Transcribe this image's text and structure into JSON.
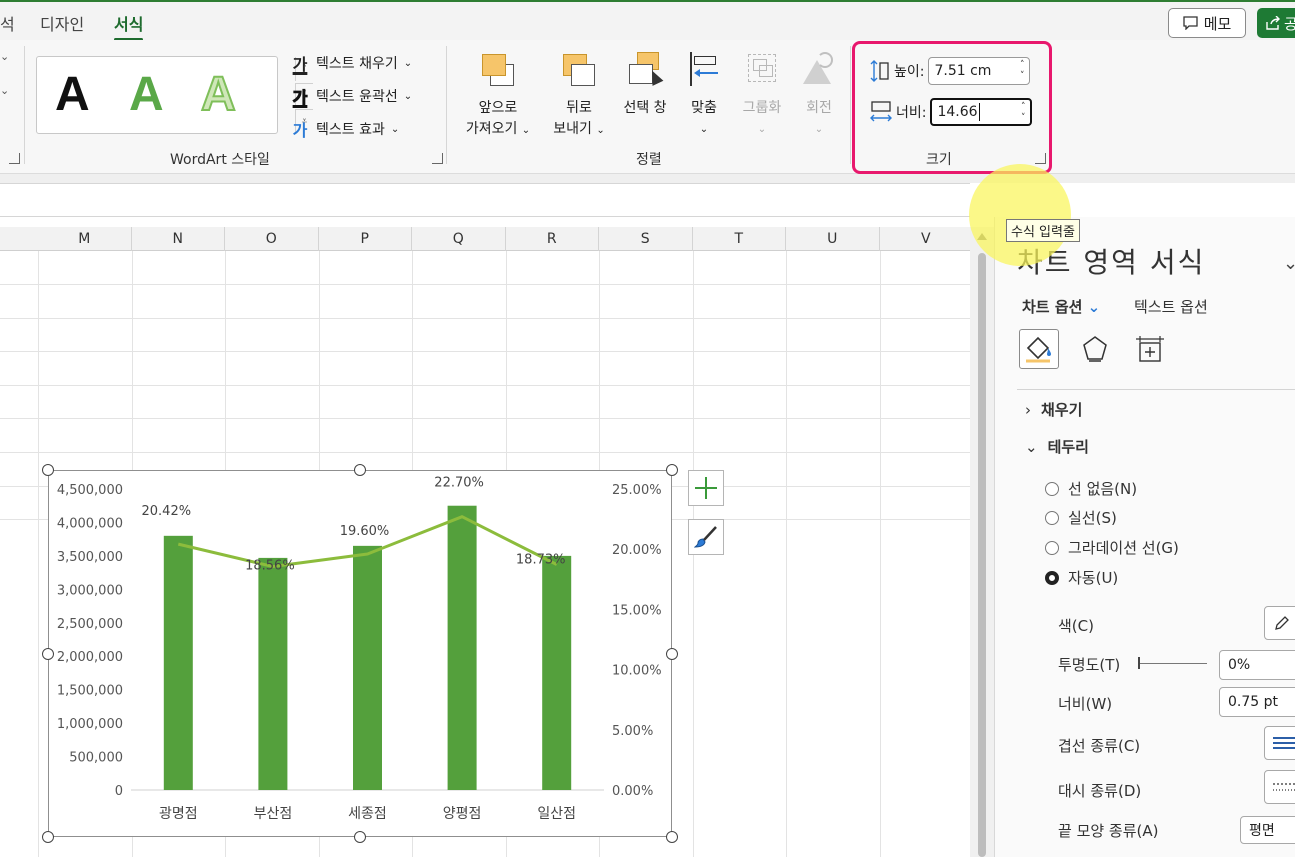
{
  "ribbon": {
    "tabs": [
      {
        "label": "석"
      },
      {
        "label": "디자인"
      },
      {
        "label": "서식"
      }
    ],
    "memo_label": "메모",
    "share_label": "공",
    "wordart": {
      "letters": [
        "A",
        "A",
        "A"
      ],
      "group_label": "WordArt 스타일",
      "commands": [
        {
          "icon_text": "가",
          "label": "텍스트 채우기"
        },
        {
          "icon_text": "가",
          "label": "텍스트 윤곽선"
        },
        {
          "icon_text": "가",
          "label": "텍스트 효과"
        }
      ]
    },
    "arrange": {
      "group_label": "정렬",
      "buttons": [
        {
          "line1": "앞으로",
          "line2": "가져오기",
          "dropdown": true,
          "disabled": false
        },
        {
          "line1": "뒤로",
          "line2": "보내기",
          "dropdown": true,
          "disabled": false
        },
        {
          "line1": "선택 창",
          "line2": "",
          "dropdown": false,
          "disabled": false
        },
        {
          "line1": "맞춤",
          "line2": "",
          "dropdown": true,
          "disabled": false
        },
        {
          "line1": "그룹화",
          "line2": "",
          "dropdown": true,
          "disabled": true
        },
        {
          "line1": "회전",
          "line2": "",
          "dropdown": true,
          "disabled": true
        }
      ]
    },
    "size": {
      "group_label": "크기",
      "height_label": "높이:",
      "height_value": "7.51 cm",
      "width_label": "너비:",
      "width_value": "14.66"
    }
  },
  "grid": {
    "columns": [
      "M",
      "N",
      "O",
      "P",
      "Q",
      "R",
      "S",
      "T",
      "U",
      "V"
    ]
  },
  "chart_data": {
    "type": "bar",
    "categories": [
      "광명점",
      "부산점",
      "세종점",
      "양평점",
      "일산점"
    ],
    "series": [
      {
        "type": "bar",
        "axis": "left",
        "values": [
          3800000,
          3470000,
          3650000,
          4250000,
          3500000
        ],
        "color": "#54a03c"
      },
      {
        "type": "line",
        "axis": "right",
        "values": [
          20.42,
          18.56,
          19.6,
          22.7,
          18.73
        ],
        "data_labels": [
          "20.42%",
          "18.56%",
          "19.60%",
          "22.70%",
          "18.73%"
        ],
        "color": "#8cbc3c"
      }
    ],
    "ylim": [
      0,
      4500000
    ],
    "y_ticks": [
      "4,500,000",
      "4,000,000",
      "3,500,000",
      "3,000,000",
      "2,500,000",
      "2,000,000",
      "1,500,000",
      "1,000,000",
      "500,000",
      "0"
    ],
    "y2lim": [
      0,
      25
    ],
    "y2_ticks": [
      "25.00%",
      "20.00%",
      "15.00%",
      "10.00%",
      "5.00%",
      "0.00%"
    ],
    "grid": false
  },
  "pane": {
    "title": "차트 영역 서식",
    "tooltip": "수식 입력줄",
    "tab_chart": "차트 옵션",
    "tab_text": "텍스트 옵션",
    "sections": {
      "fill": "채우기",
      "border": "테두리"
    },
    "border_options": [
      {
        "label": "선 없음(N)",
        "checked": false
      },
      {
        "label": "실선(S)",
        "checked": false
      },
      {
        "label": "그라데이션 선(G)",
        "checked": false
      },
      {
        "label": "자동(U)",
        "checked": true
      }
    ],
    "props": {
      "color_label": "색(C)",
      "transparency_label": "투명도(T)",
      "transparency_value": "0%",
      "width_label": "너비(W)",
      "width_value": "0.75 pt",
      "compound_label": "겹선 종류(C)",
      "dash_label": "대시 종류(D)",
      "cap_label": "끝 모양 종류(A)",
      "cap_value": "평면"
    }
  }
}
